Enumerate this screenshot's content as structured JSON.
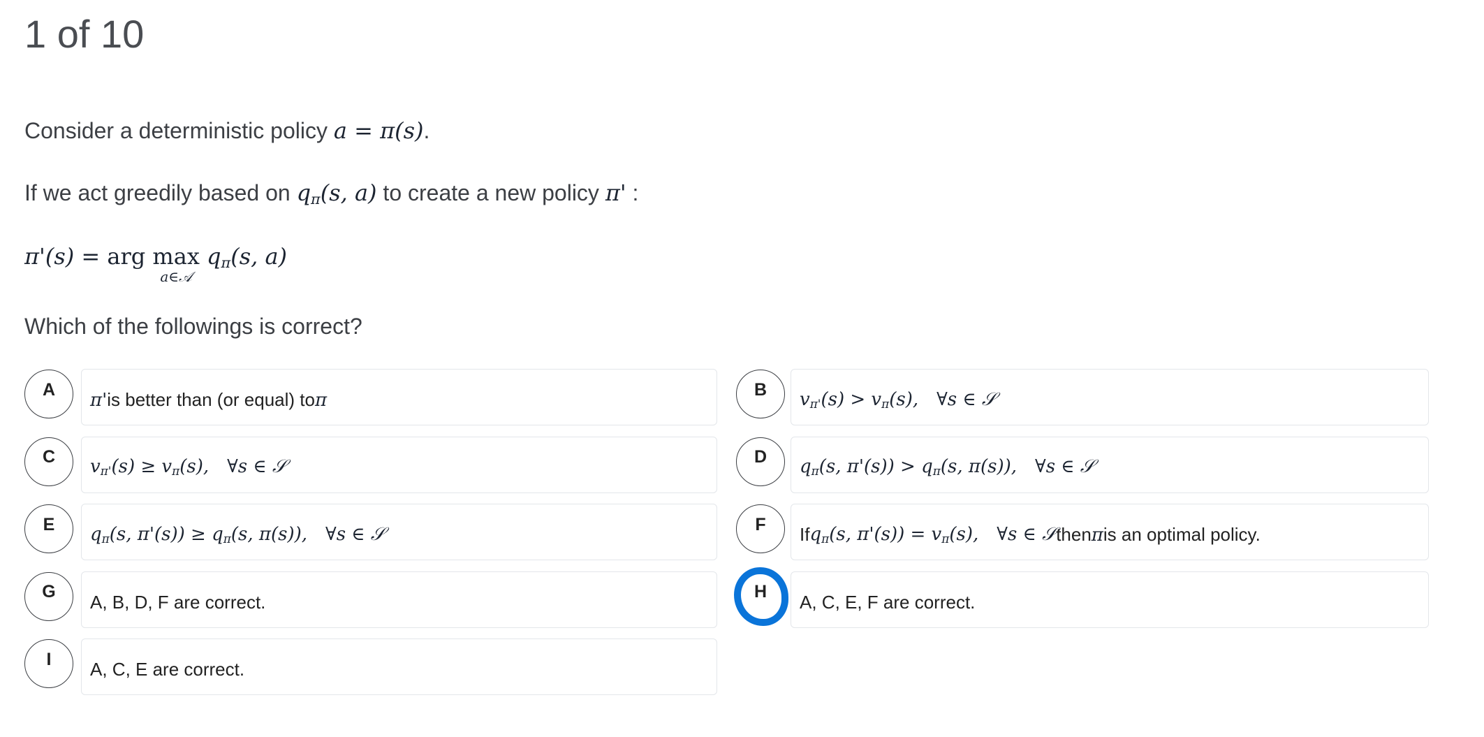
{
  "header": {
    "progress": "1 of 10"
  },
  "question": {
    "intro": "Consider a deterministic policy $a = π(s)$.",
    "greedy": "If we act greedily based on $q_{π}(s, a)$ to create a new policy $π'$ :",
    "formula": {
      "lhs": "π'(s) = ",
      "arg": "arg ",
      "max": "max",
      "limit": "a∈𝒜",
      "rhs": " q_{π}(s, a)"
    },
    "prompt": "Which of the followings is correct?"
  },
  "options": [
    {
      "letter": "A",
      "text": "$π'$ is better than (or equal) to $π$"
    },
    {
      "letter": "B",
      "text": "$v_{π'}(s) > v_{π}(s), ∀s ∈ 𝒮$"
    },
    {
      "letter": "C",
      "text": "$v_{π'}(s) ≥ v_{π}(s), ∀s ∈ 𝒮$"
    },
    {
      "letter": "D",
      "text": "$q_{π}(s, π'(s)) > q_{π}(s, π(s)), ∀s ∈ 𝒮$"
    },
    {
      "letter": "E",
      "text": "$q_{π}(s, π'(s)) ≥ q_{π}(s, π(s)), ∀s ∈ 𝒮$"
    },
    {
      "letter": "F",
      "text": "If $q_{π}(s, π'(s)) = v_{π}(s), ∀s ∈ 𝒮$ then $π$ is an optimal policy."
    },
    {
      "letter": "G",
      "text": "A, B, D, F are correct."
    },
    {
      "letter": "H",
      "text": "A, C, E, F are correct."
    },
    {
      "letter": "I",
      "text": "A, C, E are correct."
    }
  ],
  "selected": "H",
  "colors": {
    "selection_ring": "#0a74d9"
  }
}
